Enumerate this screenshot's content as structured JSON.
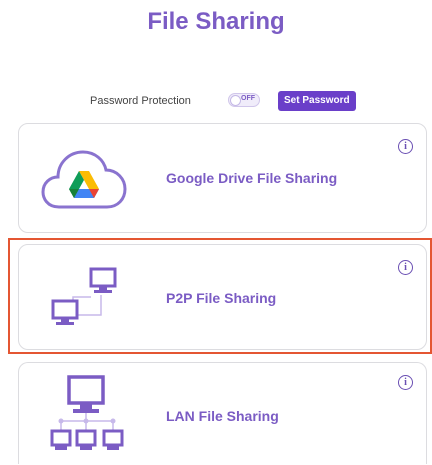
{
  "header": {
    "title": "File Sharing"
  },
  "password": {
    "label": "Password Protection",
    "toggle_state": "OFF",
    "set_button": "Set Password"
  },
  "options": [
    {
      "label": "Google Drive File Sharing",
      "icon": "google-drive-cloud-icon"
    },
    {
      "label": "P2P File Sharing",
      "icon": "p2p-computers-icon",
      "selected": true
    },
    {
      "label": "LAN File Sharing",
      "icon": "lan-network-icon"
    }
  ],
  "info_glyph": "i",
  "colors": {
    "accent": "#7b5cc4",
    "button": "#6a3fc9",
    "highlight": "#e45632"
  }
}
